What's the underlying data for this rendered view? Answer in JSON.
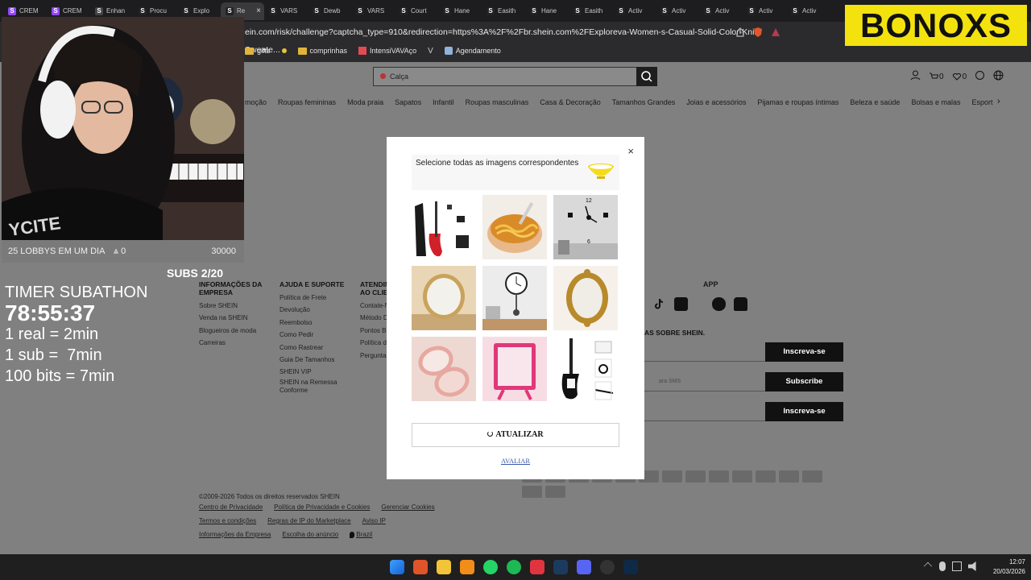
{
  "browser": {
    "tabs": [
      {
        "label": "CREM",
        "color": "#9146ff"
      },
      {
        "label": "CREM",
        "color": "#9146ff"
      },
      {
        "label": "Enhan",
        "color": "#444444"
      },
      {
        "label": "Procu",
        "color": "#222222"
      },
      {
        "label": "Explo",
        "color": "#222222"
      },
      {
        "label": "Re",
        "color": "#222222",
        "active": true
      },
      {
        "label": "VARS",
        "color": "#222222"
      },
      {
        "label": "Dewb",
        "color": "#222222"
      },
      {
        "label": "VARS",
        "color": "#222222"
      },
      {
        "label": "Court",
        "color": "#222222"
      },
      {
        "label": "Hane",
        "color": "#222222"
      },
      {
        "label": "Easith",
        "color": "#222222"
      },
      {
        "label": "Hane",
        "color": "#222222"
      },
      {
        "label": "Easith",
        "color": "#222222"
      },
      {
        "label": "Activ",
        "color": "#222222"
      },
      {
        "label": "Activ",
        "color": "#222222"
      },
      {
        "label": "Activ",
        "color": "#222222"
      },
      {
        "label": "Activ",
        "color": "#222222"
      },
      {
        "label": "Activ",
        "color": "#222222"
      }
    ],
    "url": "ein.com/risk/challenge?captcha_type=910&redirection=https%3A%2F%2Fbr.shein.com%2FExploreva-Women-s-Casual-Solid-Color-Knit-Sweate...",
    "bookmarks": [
      "gifts",
      "",
      "comprinhas",
      "IntensiVAVAço",
      "",
      "Agendamento"
    ]
  },
  "site": {
    "search_placeholder": "Calça",
    "nav": [
      "moção",
      "Roupas femininas",
      "Moda praia",
      "Sapatos",
      "Infantil",
      "Roupas masculinas",
      "Casa & Decoração",
      "Tamanhos Grandes",
      "Joias e acessórios",
      "Pijamas e roupas íntimas",
      "Beleza e saúde",
      "Bolsas e malas",
      "Esport"
    ],
    "cart_count": "0",
    "wish_count": "0",
    "footer": {
      "col1": {
        "title": "INFORMAÇÕES DA EMPRESA",
        "items": [
          "Sobre SHEIN",
          "Venda na SHEIN",
          "Blogueiros de moda",
          "Carreiras"
        ]
      },
      "col2": {
        "title": "AJUDA E SUPORTE",
        "items": [
          "Política de Frete",
          "Devolução",
          "Reembolso",
          "Como Pedir",
          "Como Rastrear",
          "Guia De Tamanhos",
          "SHEIN VIP",
          "SHEIN na Remessa Conforme"
        ]
      },
      "col3": {
        "title": "ATENDIMENTO AO CLIENTE",
        "items": [
          "Contate-N",
          "Método D",
          "Pontos B",
          "Política d",
          "Pergunta"
        ]
      },
      "app_title": "APP",
      "news_title": "AS SOBRE SHEIN.",
      "sms_placeholder": "ara SMS",
      "btn_subscribe1": "Inscreva-se",
      "btn_subscribe2": "Subscribe",
      "btn_subscribe3": "Inscreva-se",
      "copyright": "©2009-2026 Todos os direitos reservados SHEIN",
      "legal_row1": [
        "Centro de Privacidade",
        "Política de Privacidade e Cookies",
        "Gerenciar Cookies"
      ],
      "legal_row2": [
        "Termos e condições",
        "Regras de IP do Marketplace",
        "Aviso IP"
      ],
      "legal_row3": [
        "Informações da Empresa",
        "Escolha do anúncio",
        "Brazil"
      ]
    }
  },
  "stream": {
    "lobbies_text": "25 LOBBYS EM UM DIA",
    "lobbies_count": "0",
    "goal": "30000",
    "subs": "SUBS 2/20",
    "timer_title": "TIMER SUBATHON",
    "timer": "78:55:37",
    "rules": [
      "1 real = 2min",
      "1 sub =  7min",
      "100 bits = 7min"
    ],
    "logo": "BONOXS"
  },
  "captcha": {
    "prompt": "Selecione todas as imagens correspondentes",
    "refresh_label": "ATUALIZAR",
    "verify_label": "AVALIAR",
    "close_label": "×",
    "images": [
      "guitar-kit",
      "noodle-bowl",
      "wall-clock",
      "round-mirror",
      "pendulum-clock",
      "ornate-mirror",
      "compact-mirror",
      "pink-mirror",
      "bass-guitar-kit"
    ]
  },
  "taskbar": {
    "time": "12:07",
    "date": "20/03/2026"
  }
}
